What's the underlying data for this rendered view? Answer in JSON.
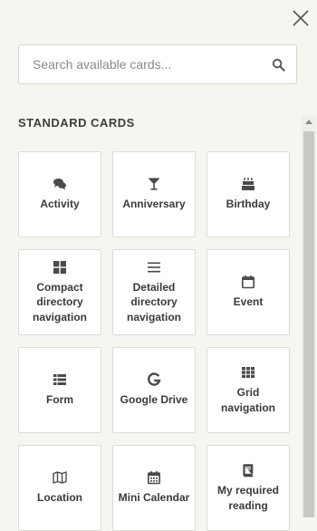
{
  "search": {
    "placeholder": "Search available cards...",
    "value": ""
  },
  "section": {
    "title": "STANDARD CARDS"
  },
  "cards": [
    {
      "label": "Activity",
      "icon": "comments-icon"
    },
    {
      "label": "Anniversary",
      "icon": "cocktail-glass-icon"
    },
    {
      "label": "Birthday",
      "icon": "birthday-cake-icon"
    },
    {
      "label": "Compact\ndirectory\nnavigation",
      "icon": "grid-large-icon"
    },
    {
      "label": "Detailed\ndirectory\nnavigation",
      "icon": "list-lines-icon"
    },
    {
      "label": "Event",
      "icon": "calendar-icon"
    },
    {
      "label": "Form",
      "icon": "form-list-icon"
    },
    {
      "label": "Google Drive",
      "icon": "google-icon"
    },
    {
      "label": "Grid navigation",
      "icon": "grid-small-icon"
    },
    {
      "label": "Location",
      "icon": "map-icon"
    },
    {
      "label": "Mini Calendar",
      "icon": "calendar-days-icon"
    },
    {
      "label": "My required\nreading",
      "icon": "book-icon"
    }
  ],
  "colors": {
    "background": "#f6f6f1",
    "card": "#ffffff",
    "text": "#3a3a3a",
    "icon": "#4a4a4a"
  }
}
